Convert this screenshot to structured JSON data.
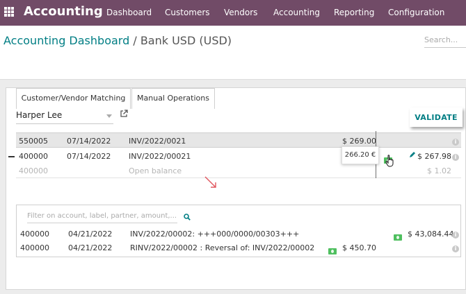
{
  "navbar": {
    "brand": "Accounting",
    "menu": [
      "Dashboard",
      "Customers",
      "Vendors",
      "Accounting",
      "Reporting",
      "Configuration"
    ]
  },
  "breadcrumb": {
    "parent": "Accounting Dashboard",
    "separator": "/",
    "current": "Bank USD (USD)"
  },
  "search": {
    "placeholder": "Search..."
  },
  "partner": {
    "value": "Harper Lee"
  },
  "validate_label": "VALIDATE",
  "lines": [
    {
      "account": "550005",
      "date": "07/14/2022",
      "label": "INV/2022/0021",
      "debit": "$ 269.00",
      "credit": ""
    },
    {
      "account": "400000",
      "date": "07/14/2022",
      "label": "INV/2022/00021",
      "debit": "",
      "credit": "$ 267.98"
    },
    {
      "account": "400000",
      "date": "",
      "label": "Open balance",
      "debit": "",
      "credit": "$ 1.02"
    }
  ],
  "tooltip": "266.20 €",
  "tabs": [
    "Customer/Vendor Matching",
    "Manual Operations"
  ],
  "filter": {
    "placeholder": "Filter on account, label, partner, amount,..."
  },
  "matches": [
    {
      "account": "400000",
      "date": "04/21/2022",
      "label": "INV/2022/00002: +++000/0000/00303+++",
      "debit": "",
      "credit": "$ 43,084.44"
    },
    {
      "account": "400000",
      "date": "04/21/2022",
      "label": "RINV/2022/00002 : Reversal of: INV/2022/00002",
      "debit": "$ 450.70",
      "credit": ""
    }
  ],
  "colors": {
    "navbar": "#714b67",
    "accent": "#017e84",
    "money": "#4fbf5f"
  }
}
